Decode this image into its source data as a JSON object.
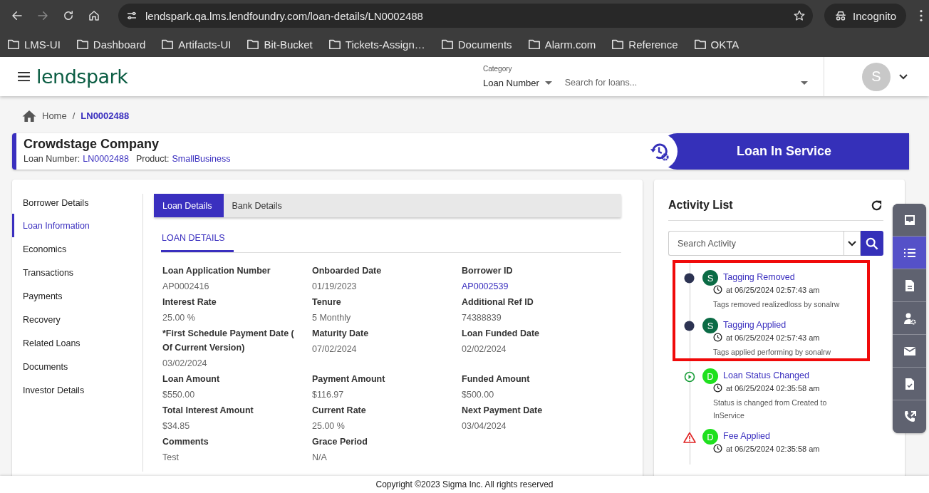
{
  "browser": {
    "url": "lendspark.qa.lms.lendfoundry.com/loan-details/LN0002488",
    "profile": "Incognito",
    "bookmarks": [
      "LMS-UI",
      "Dashboard",
      "Artifacts-UI",
      "Bit-Bucket",
      "Tickets-Assign…",
      "Documents",
      "Alarm.com",
      "Reference",
      "OKTA"
    ]
  },
  "app": {
    "logo": "lendspark",
    "category_label": "Category",
    "category": "Loan Number",
    "search_placeholder": "Search for loans...",
    "avatar": "S"
  },
  "breadcrumb": [
    "Home",
    "LN0002488"
  ],
  "breadcrumb_separator": "/",
  "loan": {
    "name": "Crowdstage Company",
    "number_label": "Loan Number:",
    "number": "LN0002488",
    "product_label": "Product:",
    "product": "SmallBusiness",
    "status": "Loan In Service"
  },
  "nav": [
    {
      "label": "Borrower Details",
      "selected": false
    },
    {
      "label": "Loan Information",
      "selected": true
    },
    {
      "label": "Economics",
      "selected": false
    },
    {
      "label": "Transactions",
      "selected": false
    },
    {
      "label": "Payments",
      "selected": false
    },
    {
      "label": "Recovery",
      "selected": false
    },
    {
      "label": "Related Loans",
      "selected": false
    },
    {
      "label": "Documents",
      "selected": false
    },
    {
      "label": "Investor Details",
      "selected": false
    }
  ],
  "tabs": [
    {
      "label": "Loan Details",
      "selected": true
    },
    {
      "label": "Bank Details",
      "selected": false
    }
  ],
  "section_tab": "LOAN DETAILS",
  "fields": [
    {
      "label": "Loan Application Number",
      "value": "AP0002416",
      "kind": "text"
    },
    {
      "label": "Onboarded Date",
      "value": "01/19/2023",
      "kind": "text"
    },
    {
      "label": "Borrower ID",
      "value": "AP0002539",
      "kind": "link"
    },
    {
      "label": "Interest Rate",
      "value": "25.00 %",
      "kind": "text"
    },
    {
      "label": "Tenure",
      "value": "5 Monthly",
      "kind": "text"
    },
    {
      "label": "Additional Ref ID",
      "value": "74388839",
      "kind": "text"
    },
    {
      "label": "*First Schedule Payment Date ( Of Current Version)",
      "value": "03/02/2024",
      "kind": "text"
    },
    {
      "label": "Maturity Date",
      "value": "07/02/2024",
      "kind": "text"
    },
    {
      "label": "Loan Funded Date",
      "value": "02/02/2024",
      "kind": "text"
    },
    {
      "label": "Loan Amount",
      "value": "$550.00",
      "kind": "text"
    },
    {
      "label": "Payment Amount",
      "value": "$116.97",
      "kind": "text"
    },
    {
      "label": "Funded Amount",
      "value": "$500.00",
      "kind": "text"
    },
    {
      "label": "Total Interest Amount",
      "value": "$34.85",
      "kind": "text"
    },
    {
      "label": "Current Rate",
      "value": "25.00 %",
      "kind": "text"
    },
    {
      "label": "Next Payment Date",
      "value": "03/04/2024",
      "kind": "text"
    },
    {
      "label": "Comments",
      "value": "Test",
      "kind": "text"
    },
    {
      "label": "Grace Period",
      "value": "N/A",
      "kind": "text"
    }
  ],
  "activity": {
    "title": "Activity List",
    "search_placeholder": "Search Activity",
    "items": [
      {
        "kind": "dot",
        "avatar": "S",
        "color": "#0b6b45",
        "title": "Tagging Removed",
        "time": "at 06/25/2024 02:57:43 am",
        "description": "Tags removed realizedloss by sonalrw",
        "highlighted": true
      },
      {
        "kind": "dot",
        "avatar": "S",
        "color": "#0b6b45",
        "title": "Tagging Applied",
        "time": "at 06/25/2024 02:57:43 am",
        "description": "Tags applied performing by sonalrw",
        "highlighted": true
      },
      {
        "kind": "play",
        "avatar": "D",
        "color": "#1fe01f",
        "title": "Loan Status Changed",
        "time": "at 06/25/2024 02:35:58 am",
        "description": "Status is changed from Created to InService",
        "highlighted": false
      },
      {
        "kind": "warning",
        "avatar": "D",
        "color": "#1fe01f",
        "title": "Fee Applied",
        "time": "at 06/25/2024 02:35:58 am",
        "highlighted": false
      }
    ]
  },
  "toolbar": [
    {
      "kind": "inbox",
      "selected": false
    },
    {
      "kind": "list",
      "selected": true
    },
    {
      "kind": "document",
      "selected": false
    },
    {
      "kind": "user-settings",
      "selected": false
    },
    {
      "kind": "mail",
      "selected": false
    },
    {
      "kind": "document-check",
      "selected": false
    },
    {
      "kind": "phone",
      "selected": false
    }
  ],
  "footer": "Copyright ©2023 Sigma Inc. All rights reserved"
}
